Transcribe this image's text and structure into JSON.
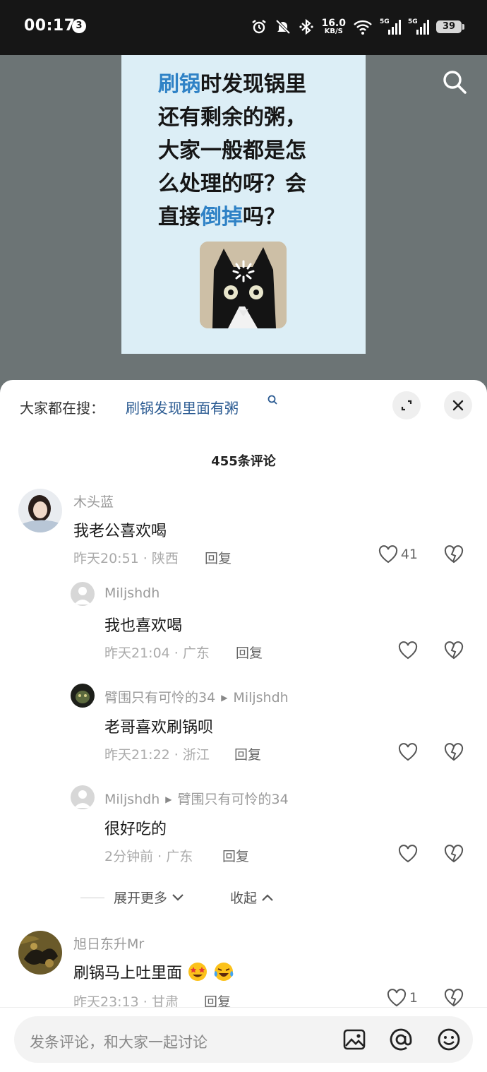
{
  "status_bar": {
    "time": "00:17",
    "notification_count": "3",
    "net_speed_value": "16.0",
    "net_speed_unit": "KB/S",
    "signal1_label": "5G",
    "signal2_label": "5G",
    "battery": "39"
  },
  "post": {
    "line1_highlight": "刷锅",
    "line1_rest": "时发现锅里",
    "line2": "还有剩余的粥，",
    "line3": "大家一般都是怎",
    "line4": "么处理的呀？会",
    "line5_start": "直接",
    "line5_highlight": "倒掉",
    "line5_end": "吗？"
  },
  "everyone_searching": {
    "label": "大家都在搜：",
    "query": "刷锅发现里面有粥"
  },
  "comments_count": "455条评论",
  "comments": [
    {
      "name": "木头蓝",
      "text": "我老公喜欢喝",
      "time": "昨天20:51",
      "location": "陕西",
      "reply_label": "回复",
      "likes": "41"
    },
    {
      "name": "Miljshdh",
      "text": "我也喜欢喝",
      "time": "昨天21:04",
      "location": "广东",
      "reply_label": "回复"
    },
    {
      "name": "臂围只有可怜的34",
      "reply_to": "Miljshdh",
      "text": "老哥喜欢刷锅呗",
      "time": "昨天21:22",
      "location": "浙江",
      "reply_label": "回复"
    },
    {
      "name": "Miljshdh",
      "reply_to": "臂围只有可怜的34",
      "text": "很好吃的",
      "time": "2分钟前",
      "location": "广东",
      "reply_label": "回复"
    },
    {
      "name": "旭日东升Mr",
      "text": "刷锅马上吐里面",
      "time": "昨天23:13",
      "location": "甘肃",
      "reply_label": "回复",
      "likes": "1"
    }
  ],
  "meta_separator": " · ",
  "expand_more": "展开更多",
  "collapse": "收起",
  "input": {
    "placeholder": "发条评论，和大家一起讨论"
  },
  "colors": {
    "highlight_blue": "#2f82c6",
    "search_query_blue": "#2b5b92"
  }
}
